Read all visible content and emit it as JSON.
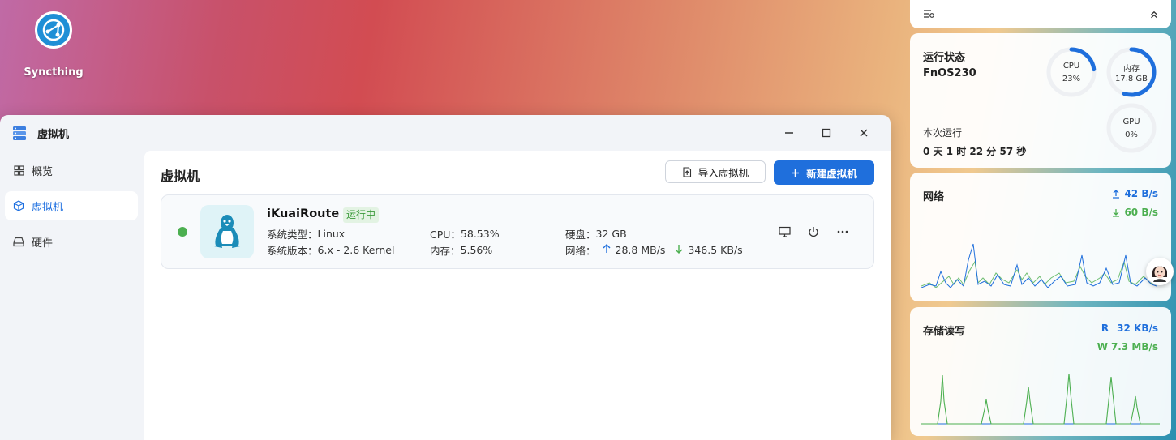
{
  "desktop": {
    "icons": [
      {
        "label": "Syncthing",
        "icon": "syncthing-icon"
      }
    ]
  },
  "window": {
    "title": "虚拟机",
    "controls": [
      "minimize",
      "maximize",
      "close"
    ],
    "sidebar": {
      "items": [
        {
          "label": "概览",
          "icon": "grid-icon",
          "active": false
        },
        {
          "label": "虚拟机",
          "icon": "cube-icon",
          "active": true
        },
        {
          "label": "硬件",
          "icon": "drive-icon",
          "active": false
        }
      ]
    },
    "main": {
      "title": "虚拟机",
      "import_label": "导入虚拟机",
      "new_label": "新建虚拟机",
      "vm": {
        "name": "iKuaiRoute",
        "status": "运行中",
        "status_color": "#4caf50",
        "os_type_label": "系统类型：",
        "os_type": "Linux",
        "os_version_label": "系统版本：",
        "os_version": "6.x - 2.6 Kernel",
        "cpu_label": "CPU：",
        "cpu": "58.53%",
        "mem_label": "内存：",
        "mem": "5.56%",
        "disk_label": "硬盘：",
        "disk": "32 GB",
        "net_label": "网络：",
        "net_up": "28.8 MB/s",
        "net_down": "346.5 KB/s"
      }
    }
  },
  "widgets": {
    "status": {
      "title": "运行状态",
      "hostname": "FnOS230",
      "uptime_label": "本次运行",
      "uptime": "0 天 1 时 22 分 57 秒",
      "cpu": {
        "label": "CPU",
        "value": "23%",
        "percent": 23
      },
      "mem": {
        "label": "内存",
        "value": "17.8 GB",
        "percent": 55
      },
      "gpu": {
        "label": "GPU",
        "value": "0%",
        "percent": 0
      }
    },
    "network": {
      "title": "网络",
      "up": "42 B/s",
      "down": "60 B/s"
    },
    "storage": {
      "title": "存储读写",
      "read_label": "R",
      "read": "32 KB/s",
      "write_label": "W",
      "write": "7.3 MB/s"
    }
  },
  "colors": {
    "accent": "#1f6fdc",
    "green": "#4caf50"
  }
}
